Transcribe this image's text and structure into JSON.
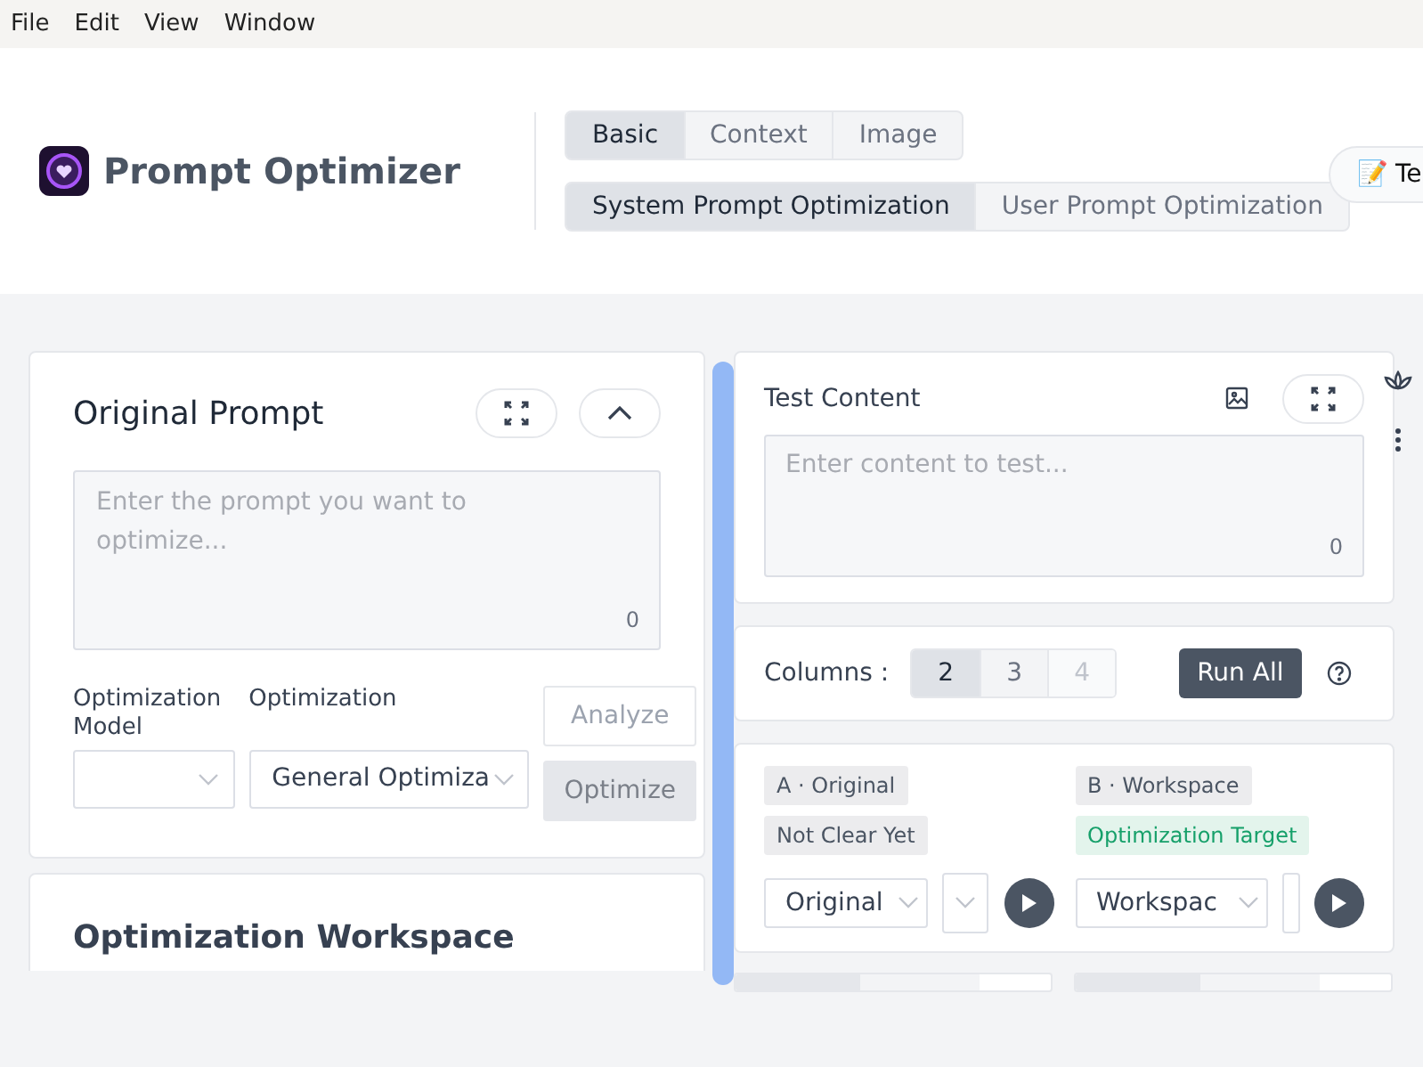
{
  "menu": [
    "File",
    "Edit",
    "View",
    "Window"
  ],
  "app": {
    "title": "Prompt Optimizer"
  },
  "mode_tabs": [
    {
      "label": "Basic",
      "selected": true
    },
    {
      "label": "Context",
      "selected": false
    },
    {
      "label": "Image",
      "selected": false
    }
  ],
  "sub_tabs": [
    {
      "label": "System Prompt Optimization",
      "selected": true
    },
    {
      "label": "User Prompt Optimization",
      "selected": false
    }
  ],
  "header_button": {
    "icon": "📝",
    "label": "Te"
  },
  "original_prompt": {
    "title": "Original Prompt",
    "placeholder": "Enter the prompt you want to optimize...",
    "count": "0",
    "model": {
      "label": "Optimization Model"
    },
    "template": {
      "label": "Optimization",
      "value": "General Optimiza"
    },
    "analyze": {
      "label": "Analyze",
      "disabled": false
    },
    "optimize": {
      "label": "Optimize",
      "disabled": true
    }
  },
  "workspace": {
    "title": "Optimization Workspace"
  },
  "test_content": {
    "title": "Test Content",
    "placeholder": "Enter content to test...",
    "count": "0"
  },
  "columns": {
    "label": "Columns :",
    "options": [
      {
        "label": "2",
        "selected": true,
        "disabled": false
      },
      {
        "label": "3",
        "selected": false,
        "disabled": false
      },
      {
        "label": "4",
        "selected": false,
        "disabled": true
      }
    ],
    "run_all": "Run All"
  },
  "results": [
    {
      "tags": [
        {
          "label": "A · Original",
          "kind": "plain"
        },
        {
          "label": "Not Clear Yet",
          "kind": "plain"
        }
      ],
      "select": "Original"
    },
    {
      "tags": [
        {
          "label": "B · Workspace",
          "kind": "plain"
        },
        {
          "label": "Optimization Target",
          "kind": "target"
        }
      ],
      "select": "Workspac"
    }
  ]
}
